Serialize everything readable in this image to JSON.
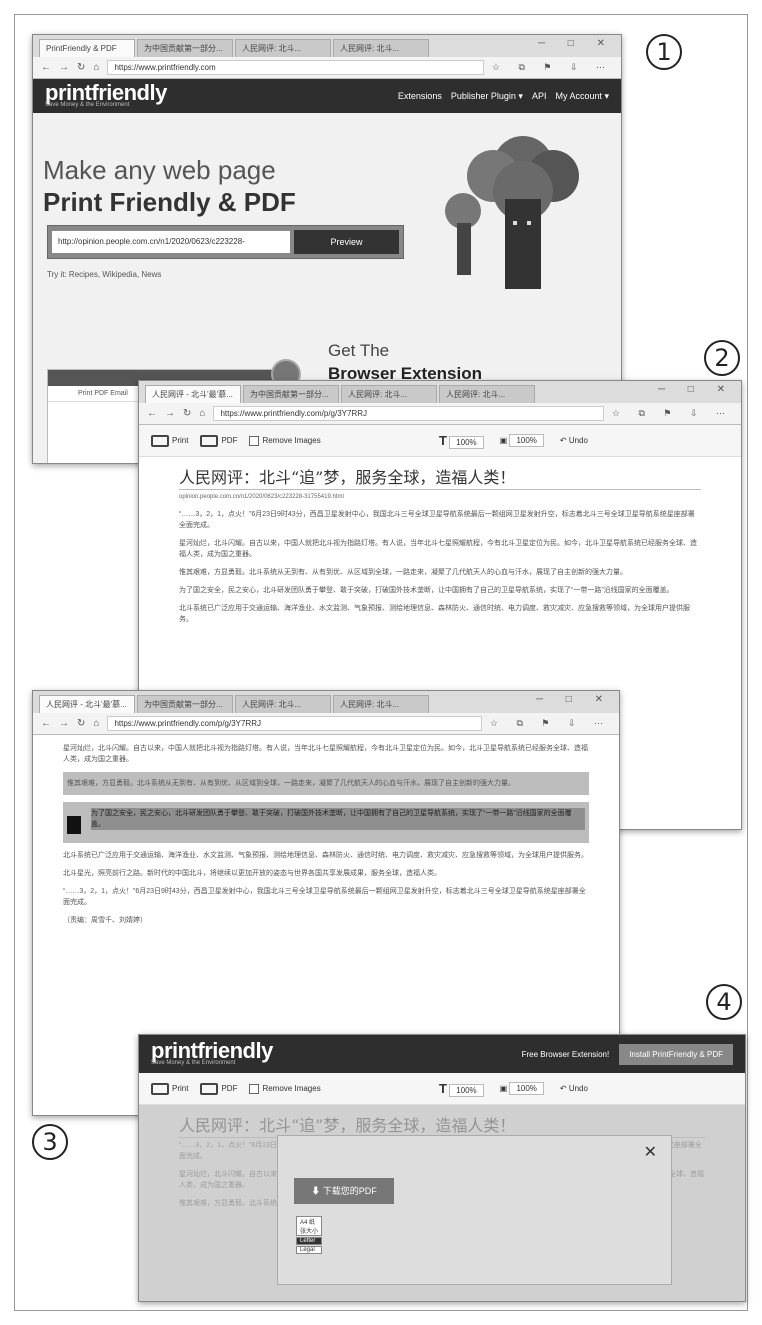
{
  "labels": {
    "n1": "1",
    "n2": "2",
    "n3": "3",
    "n4": "4"
  },
  "browser": {
    "tabs_1": [
      "PrintFriendly & PDF",
      "为中国贡献第一部分...",
      "人民网评: 北斗...",
      "人民网评: 北斗..."
    ],
    "tabs_2": [
      "人民网评 - 北斗'最'慕...",
      "为中国贡献第一部分...",
      "人民网评: 北斗...",
      "人民网评: 北斗..."
    ],
    "url_1": "https://www.printfriendly.com",
    "url_2": "https://www.printfriendly.com/p/g/3Y7RRJ",
    "win_controls": "─ □ ✕",
    "toolbar_icons": "☆ ⧉ ⚑ ⇩ ⋯"
  },
  "printfriendly": {
    "logo": "printfriendly",
    "tagline": "Save Money & the Environment",
    "nav": [
      "Extensions",
      "Publisher Plugin ▾",
      "API",
      "My Account ▾"
    ],
    "headline_1": "Make any web page",
    "headline_2": "Print Friendly & PDF",
    "url_value": "http://opinion.people.com.cn/n1/2020/0623/c223228-",
    "preview_btn": "Preview",
    "try_it": "Try it: Recipes, Wikipedia, News",
    "get_the": "Get The",
    "browser_extension": "Browser Extension",
    "ext_icons": [
      "⚡",
      "👍",
      "☺"
    ],
    "mini_toolbar": "Print   PDF   Email",
    "free_ext": "Free Browser Extension!",
    "install_btn": "Install PrintFriendly & PDF"
  },
  "print_toolbar": {
    "print": "Print",
    "pdf": "PDF",
    "email": "Email",
    "remove_images": "Remove Images",
    "text_size": "100%",
    "image_size": "100%",
    "undo": "↶ Undo"
  },
  "article": {
    "title": "人民网评：北斗“追”梦，服务全球，造福人类！",
    "source": "opinion.people.com.cn/n1/2020/0623/c223228-31755419.html",
    "p1": "“……3，2，1，点火！”6月23日9时43分，西昌卫星发射中心，我国北斗三号全球卫星导航系统最后一颗组网卫星发射升空，标志着北斗三号全球卫星导航系统星座部署全面完成。",
    "p2": "星河灿烂，北斗闪耀。自古以来，中国人就把北斗视为指路灯塔。有人说，当年北斗七星照耀航程，今有北斗卫星定位为民。如今，北斗卫星导航系统已经服务全球、造福人类，成为国之重器。",
    "p3": "惟其艰难，方显勇毅。北斗系统从无到有、从有到优、从区域到全球，一路走来，凝聚了几代航天人的心血与汗水，展现了自主创新的强大力量。",
    "p4": "为了国之安全，民之安心，北斗研发团队勇于攀登、敢于突破，打破国外技术垄断，让中国拥有了自己的卫星导航系统，实现了“一带一路”沿线国家的全面覆盖。",
    "p5": "北斗系统已广泛应用于交通运输、海洋渔业、水文监测、气象预报、测绘地理信息、森林防火、通信时统、电力调度、救灾减灾、应急搜救等领域，为全球用户提供服务。",
    "p6": "北斗星光，照亮前行之路。新时代的中国北斗，将继续以更加开放的姿态与世界各国共享发展成果，服务全球，造福人类。",
    "editor": "（责编：周雪千、刘婧婷）"
  },
  "download": {
    "button": "下载您的PDF",
    "size_label": "纸张大小",
    "sizes": [
      "A4",
      "Letter",
      "Legal"
    ]
  }
}
